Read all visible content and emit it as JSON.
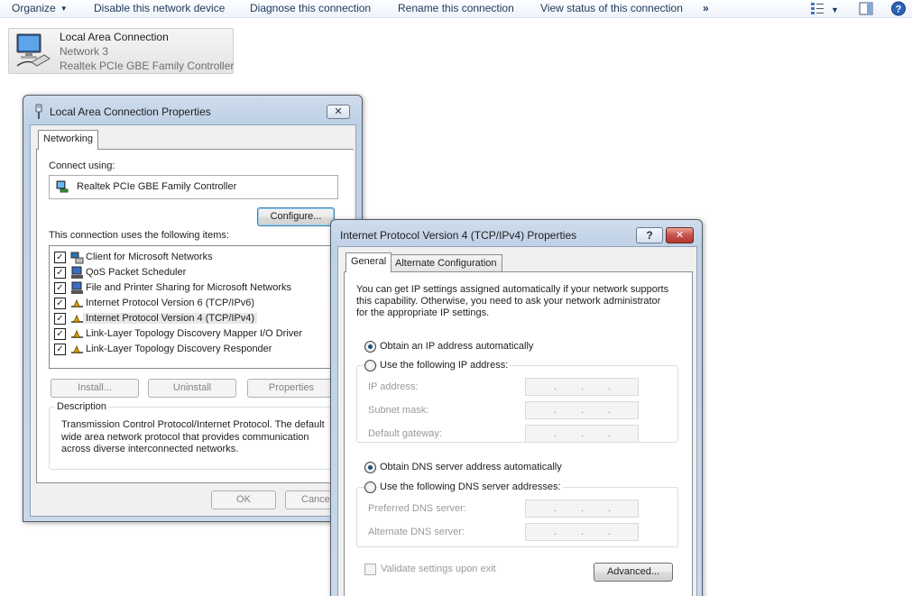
{
  "commandbar": {
    "items": [
      {
        "label": "Organize"
      },
      {
        "label": "Disable this network device"
      },
      {
        "label": "Diagnose this connection"
      },
      {
        "label": "Rename this connection"
      },
      {
        "label": "View status of this connection"
      },
      {
        "label": "»"
      }
    ],
    "icons": [
      "change-view-icon",
      "view-dropdown-icon",
      "preview-pane-icon",
      "help-icon"
    ]
  },
  "connection_tile": {
    "name": "Local Area Connection",
    "network": "Network  3",
    "adapter": "Realtek PCIe GBE Family Controller",
    "icon": "network-adapter-icon"
  },
  "lac_properties": {
    "title": "Local Area Connection Properties",
    "tab": "Networking",
    "connect_using_label": "Connect using:",
    "adapter_name": "Realtek PCIe GBE Family Controller",
    "configure_button": "Configure...",
    "items_label": "This connection uses the following items:",
    "items": [
      {
        "label": "Client for Microsoft Networks",
        "checked": true,
        "icon": "network-client-icon"
      },
      {
        "label": "QoS Packet Scheduler",
        "checked": true,
        "icon": "network-service-icon"
      },
      {
        "label": "File and Printer Sharing for Microsoft Networks",
        "checked": true,
        "icon": "network-service-icon"
      },
      {
        "label": "Internet Protocol Version 6 (TCP/IPv6)",
        "checked": true,
        "icon": "protocol-icon"
      },
      {
        "label": "Internet Protocol Version 4 (TCP/IPv4)",
        "checked": true,
        "icon": "protocol-icon",
        "selected": true
      },
      {
        "label": "Link-Layer Topology Discovery Mapper I/O Driver",
        "checked": true,
        "icon": "protocol-icon"
      },
      {
        "label": "Link-Layer Topology Discovery Responder",
        "checked": true,
        "icon": "protocol-icon"
      }
    ],
    "install_button": "Install...",
    "uninstall_button": "Uninstall",
    "properties_button": "Properties",
    "description_label": "Description",
    "description_text_1": "Transmission Control Protocol/Internet Protocol. The default",
    "description_text_2": "wide area network protocol that provides communication",
    "description_text_3": "across diverse interconnected networks.",
    "ok_button": "OK",
    "cancel_button": "Cance"
  },
  "ipv4_properties": {
    "title": "Internet Protocol Version 4 (TCP/IPv4) Properties",
    "help_button": "?",
    "close_button": "✕",
    "tabs": [
      "General",
      "Alternate Configuration"
    ],
    "intro_1": "You can get IP settings assigned automatically if your network supports",
    "intro_2": "this capability. Otherwise, you need to ask your network administrator",
    "intro_3": "for the appropriate IP settings.",
    "obtain_ip_auto": "Obtain an IP address automatically",
    "use_following_ip": "Use the following IP address:",
    "ip_address_label": "IP address:",
    "subnet_mask_label": "Subnet mask:",
    "default_gateway_label": "Default gateway:",
    "obtain_dns_auto": "Obtain DNS server address automatically",
    "use_following_dns": "Use the following DNS server addresses:",
    "preferred_dns_label": "Preferred DNS server:",
    "alternate_dns_label": "Alternate DNS server:",
    "ip_dots": ".",
    "validate_label": "Validate settings upon exit",
    "advanced_button": "Advanced...",
    "ip_mode": "automatic",
    "dns_mode": "automatic",
    "validate_checked": false
  }
}
